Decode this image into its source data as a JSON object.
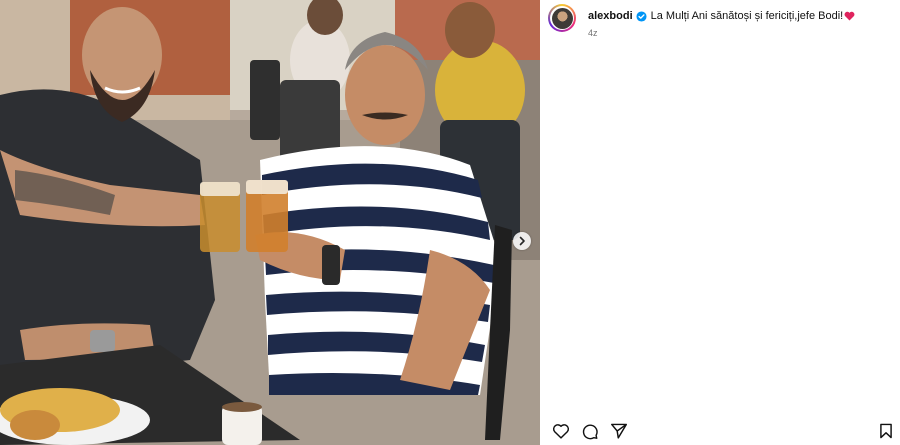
{
  "post": {
    "username": "alexbodi",
    "caption": "La Mulți Ani sănătoși și fericiți,jefe Bodi!",
    "time": "4z",
    "verified": true
  },
  "icons": {
    "avatar": "avatar",
    "verified": "verified-badge-icon",
    "heart_emoji": "red-heart-emoji",
    "next": "chevron-right-icon",
    "like": "heart-outline-icon",
    "comment": "comment-bubble-icon",
    "share": "paper-plane-icon",
    "save": "bookmark-icon"
  },
  "colors": {
    "verified": "#0095f6",
    "heart": "#e0245e",
    "text": "#111111",
    "muted": "#737373"
  }
}
